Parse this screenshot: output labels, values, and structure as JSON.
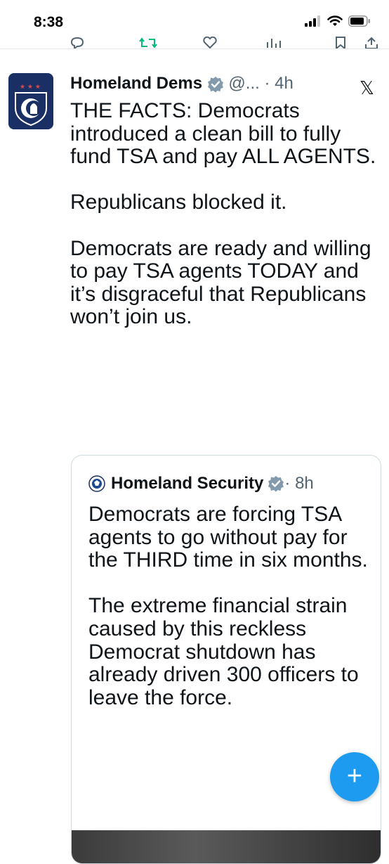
{
  "status_bar": {
    "time": "8:38"
  },
  "tweet": {
    "author_name": "Homeland Dems",
    "handle_time": " @... · 4h",
    "paragraphs": [
      "THE FACTS: Democrats introduced a clean bill to fully fund TSA and pay ALL AGENTS.",
      "Republicans blocked it.",
      "Democrats are ready and willing to pay TSA agents TODAY and it’s disgraceful that Republicans won’t join us."
    ],
    "platform_logo": "𝕏"
  },
  "quote": {
    "author_name": "Homeland Security",
    "time": " · 8h",
    "paragraphs": [
      "Democrats are forcing TSA agents to go without pay for the THIRD time in six months.",
      "The extreme financial strain caused by this reckless Democrat shutdown has already driven 300 officers to leave the force."
    ]
  },
  "fab_label": "+",
  "colors": {
    "accent": "#1d9bf0",
    "avatar_bg": "#1a2f63",
    "muted": "#536471",
    "border": "#cfd9de"
  },
  "icons": [
    "signal-icon",
    "wifi-icon",
    "battery-icon",
    "reply-icon",
    "retweet-icon",
    "like-icon",
    "views-icon",
    "bookmark-icon",
    "share-icon",
    "verified-badge-icon",
    "dhs-seal-icon",
    "x-logo-icon",
    "plus-icon"
  ]
}
